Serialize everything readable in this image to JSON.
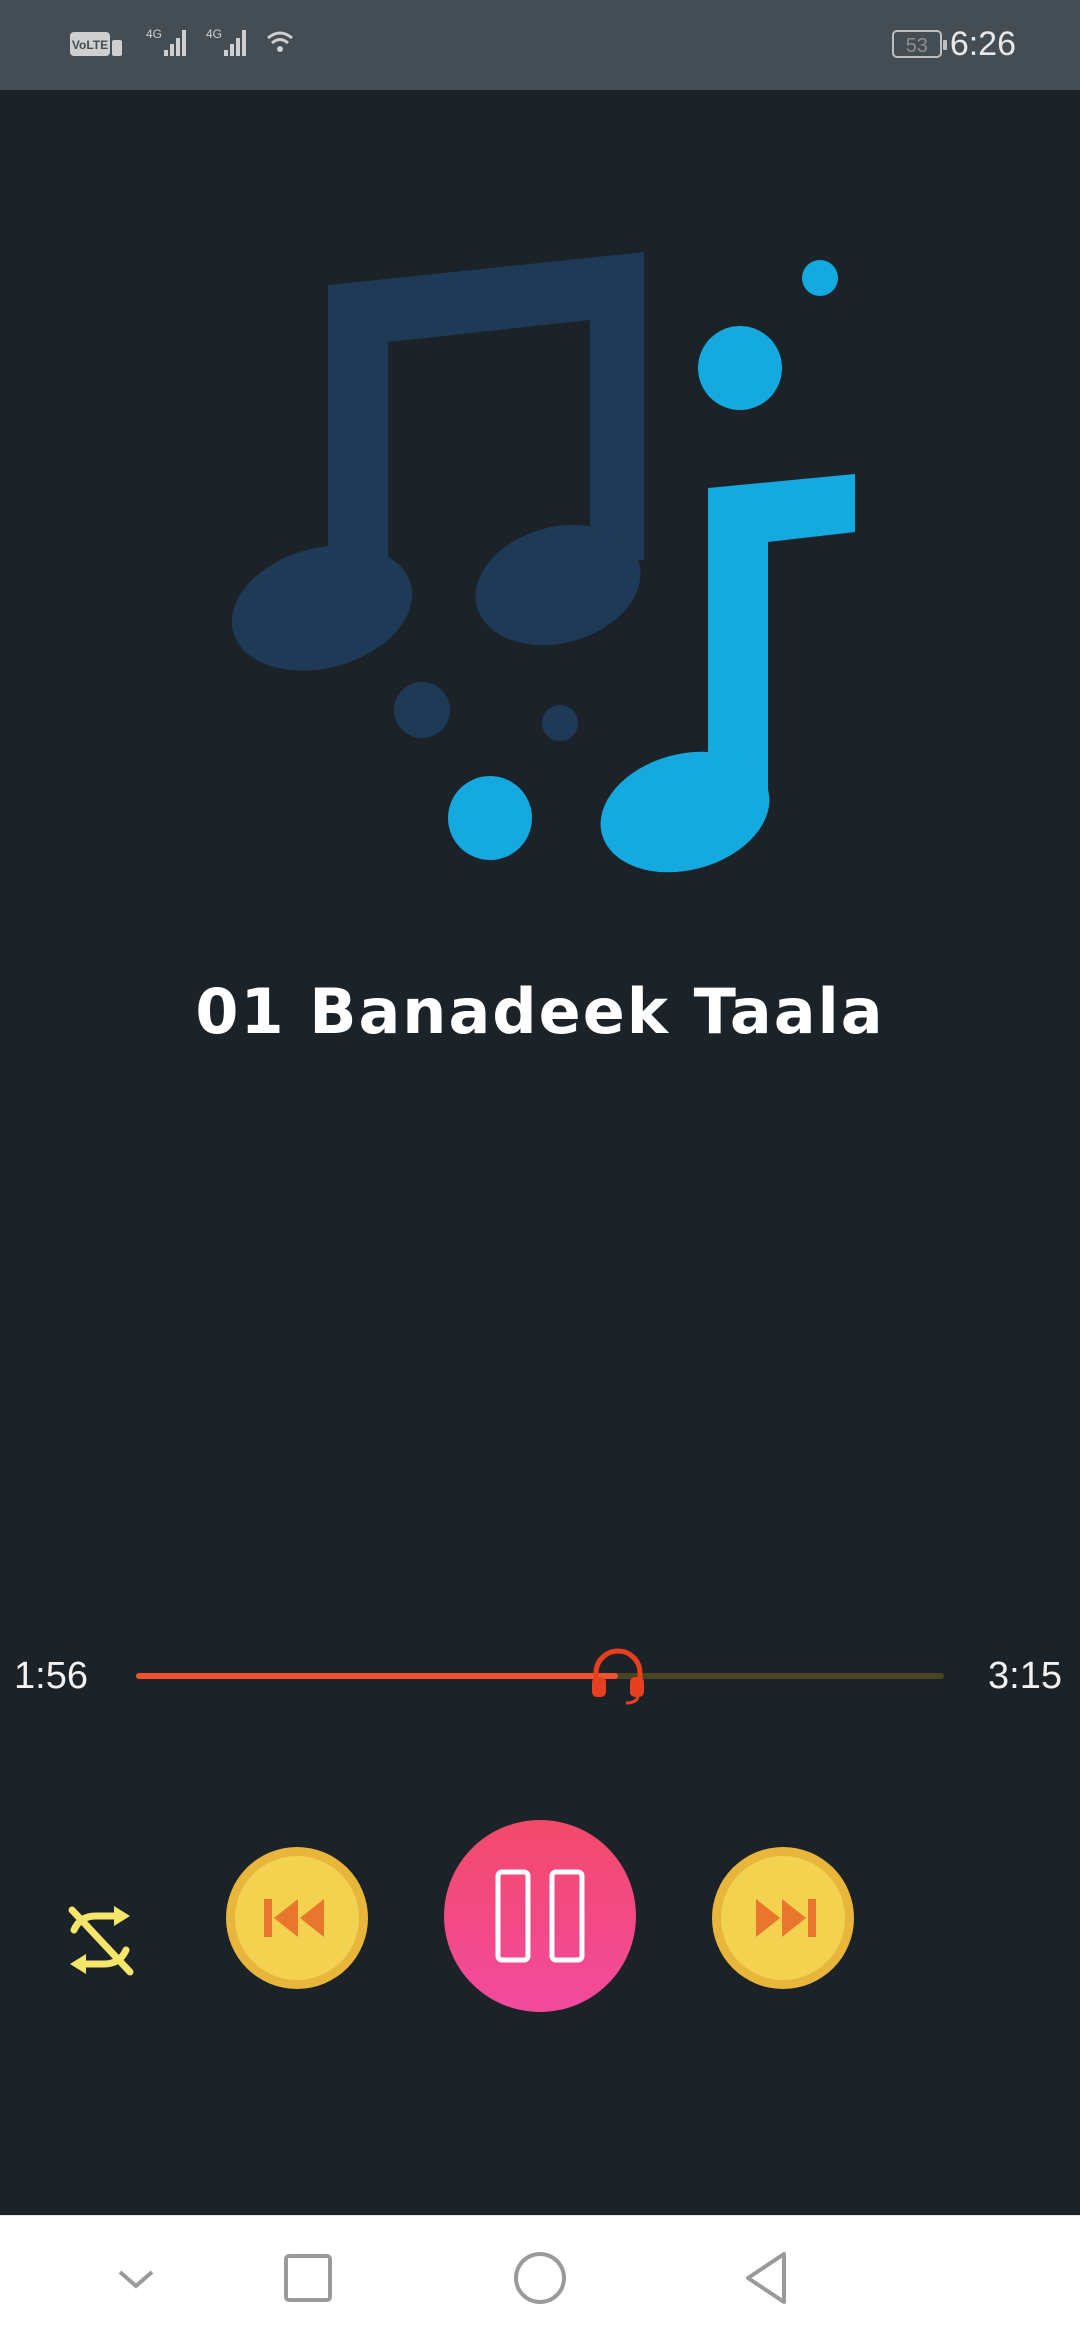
{
  "status_bar": {
    "battery_level": "53",
    "time": "6:26",
    "network_label": "4G",
    "volte_label": "VoLTE"
  },
  "player": {
    "song_title": "01 Banadeek Taala",
    "elapsed_time": "1:56",
    "total_time": "3:15",
    "progress_fraction": 0.596,
    "is_playing": true,
    "shuffle_on": false
  },
  "colors": {
    "background": "#1b2228",
    "note_dark": "#1e3a56",
    "note_light": "#14a9df",
    "seek_played": "#f0522e",
    "seek_remaining": "#4a4422",
    "skip_button": "#f2d24f",
    "play_button": "#f24674",
    "shuffle_icon": "#f5e66a"
  },
  "icons": {
    "artwork": "music-notes-icon",
    "shuffle": "shuffle-off-icon",
    "prev": "skip-previous-icon",
    "play_pause": "pause-icon",
    "next": "skip-next-icon",
    "seek_thumb": "headphones-icon"
  },
  "nav_bar": {
    "items": [
      "dropdown",
      "recents",
      "home",
      "back"
    ]
  }
}
